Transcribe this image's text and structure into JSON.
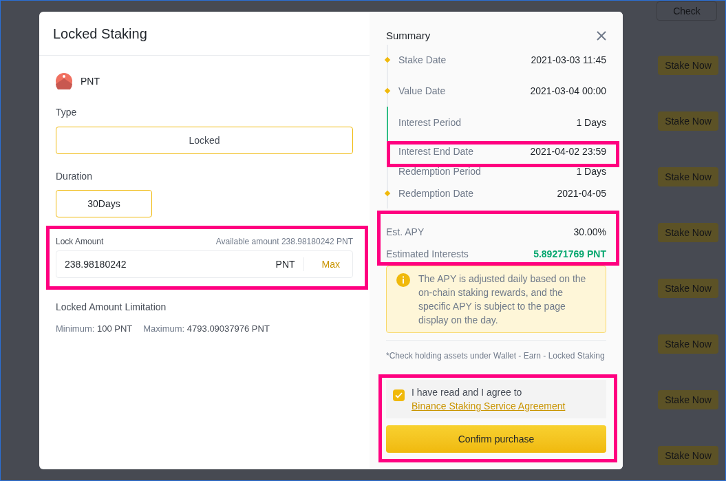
{
  "background": {
    "top_row": {
      "action": "Check"
    },
    "stake_buttons": [
      "Stake Now",
      "Stake Now",
      "Stake Now",
      "Stake Now",
      "Stake Now",
      "Stake Now",
      "Stake Now",
      "Stake Now"
    ]
  },
  "dialog": {
    "title": "Locked Staking",
    "coin": "PNT",
    "type": {
      "label": "Type",
      "options": [
        {
          "label": "Locked",
          "selected": true
        }
      ]
    },
    "duration": {
      "label": "Duration",
      "options": [
        {
          "label": "30Days",
          "selected": true
        }
      ]
    },
    "lock_amount": {
      "label": "Lock Amount",
      "available": "Available amount 238.98180242 PNT",
      "value": "238.98180242",
      "unit": "PNT",
      "max": "Max"
    },
    "limitation": {
      "title": "Locked Amount Limitation",
      "minimum_label": "Minimum:",
      "minimum": "100 PNT",
      "maximum_label": "Maximum:",
      "maximum": "4793.09037976 PNT"
    },
    "summary": {
      "title": "Summary",
      "timeline": [
        {
          "label": "Stake Date",
          "value": "2021-03-03 11:45",
          "marker": true,
          "elapsed": false
        },
        {
          "label": "Value Date",
          "value": "2021-03-04 00:00",
          "marker": true,
          "elapsed": false
        },
        {
          "label": "Interest Period",
          "value": "1 Days",
          "marker": false,
          "elapsed": true
        },
        {
          "label": "Interest End Date",
          "value": "2021-04-02 23:59",
          "marker": false,
          "elapsed": true
        },
        {
          "label": "Redemption Period",
          "value": "1 Days",
          "marker": false,
          "elapsed": false
        },
        {
          "label": "Redemption Date",
          "value": "2021-04-05",
          "marker": true,
          "elapsed": false
        }
      ],
      "apy_label": "Est. APY",
      "apy": "30.00%",
      "interest_label": "Estimated Interests",
      "interest": "5.89271769 PNT",
      "notice": "The APY is adjusted daily based on the on-chain staking rewards, and the specific APY is subject to the page display on the day.",
      "footnote": "*Check holding assets under Wallet - Earn - Locked Staking",
      "agreement": {
        "checked": true,
        "text": "I have read and I agree to",
        "link": "Binance Staking Service Agreement"
      },
      "confirm": "Confirm purchase"
    }
  }
}
